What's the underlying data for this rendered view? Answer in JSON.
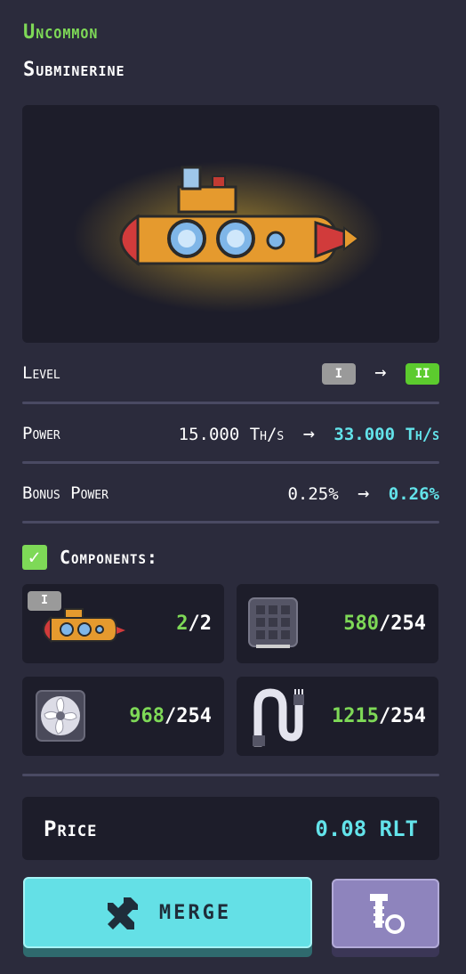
{
  "miner": {
    "rarity": "Uncommon",
    "name": "Subminerine",
    "image_icon": "submarine-icon"
  },
  "stats": {
    "level": {
      "label": "Level",
      "from": "I",
      "to": "II"
    },
    "power": {
      "label": "Power",
      "from": "15.000 Th/s",
      "to": "33.000 Th/s"
    },
    "bonus_power": {
      "label": "Bonus Power",
      "from": "0.25%",
      "to": "0.26%"
    }
  },
  "components": {
    "label": "Components:",
    "checked": true,
    "items": [
      {
        "icon": "submarine-icon",
        "level_badge": "I",
        "have": "2",
        "need": "/2"
      },
      {
        "icon": "circuit-board-icon",
        "have": "580",
        "need": "/254"
      },
      {
        "icon": "fan-icon",
        "have": "968",
        "need": "/254"
      },
      {
        "icon": "cable-icon",
        "have": "1215",
        "need": "/254"
      }
    ]
  },
  "price": {
    "label": "Price",
    "value": "0.08 RLT"
  },
  "actions": {
    "merge_label": "MERGE",
    "merge_icon": "wrench-icon",
    "tool_icon": "screw-icon"
  },
  "colors": {
    "accent_cyan": "#63e3ea",
    "rarity_green": "#7ed957",
    "background": "#2b2b3c",
    "panel": "#1d1d2a",
    "secondary_button": "#8e84bd"
  }
}
